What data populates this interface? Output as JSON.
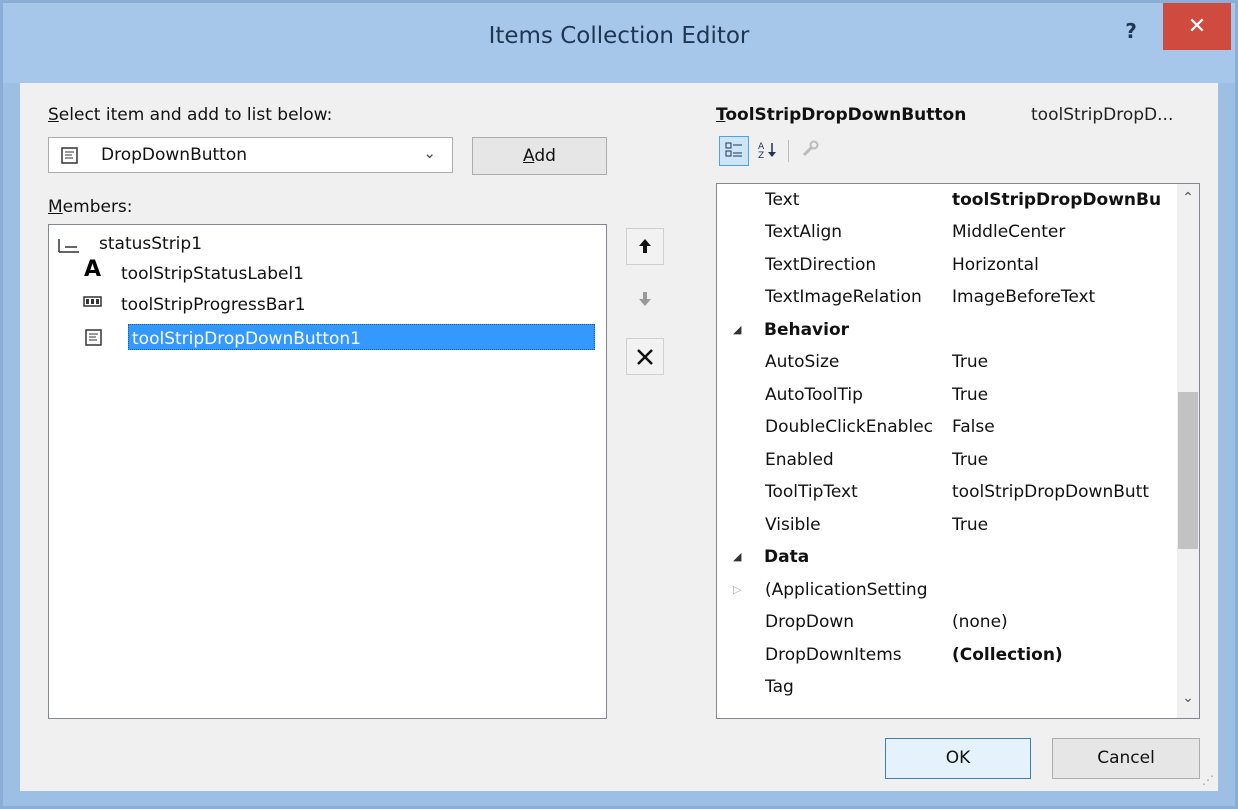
{
  "window": {
    "title": "Items Collection Editor",
    "help_glyph": "?",
    "close_glyph": "✕"
  },
  "left": {
    "select_label_u": "S",
    "select_label_rest": "elect item and add to list below:",
    "combo_value": "DropDownButton",
    "add_label_u": "A",
    "add_label_rest": "dd",
    "members_label_u": "M",
    "members_label_rest": "embers:",
    "tree": [
      {
        "label": "statusStrip1",
        "icon": "status-strip-icon"
      },
      {
        "label": "toolStripStatusLabel1",
        "icon": "label-a-icon"
      },
      {
        "label": "toolStripProgressBar1",
        "icon": "progress-bar-icon"
      },
      {
        "label": "toolStripDropDownButton1",
        "icon": "dropdown-button-icon",
        "selected": true
      }
    ]
  },
  "side_buttons": {
    "up": "move-up-arrow-icon",
    "down": "move-down-arrow-icon",
    "remove": "delete-x-icon"
  },
  "right": {
    "type_name_u": "T",
    "type_name_rest": "oolStripDropDownButton",
    "object_name": "toolStripDropD...",
    "properties": [
      {
        "name": "Text",
        "value": "toolStripDropDownBu",
        "bold_value": true
      },
      {
        "name": "TextAlign",
        "value": "MiddleCenter"
      },
      {
        "name": "TextDirection",
        "value": "Horizontal"
      },
      {
        "name": "TextImageRelation",
        "value": "ImageBeforeText"
      },
      {
        "name": "Behavior",
        "category": true
      },
      {
        "name": "AutoSize",
        "value": "True"
      },
      {
        "name": "AutoToolTip",
        "value": "True"
      },
      {
        "name": "DoubleClickEnablec",
        "value": "False"
      },
      {
        "name": "Enabled",
        "value": "True"
      },
      {
        "name": "ToolTipText",
        "value": "toolStripDropDownButt"
      },
      {
        "name": "Visible",
        "value": "True"
      },
      {
        "name": "Data",
        "category": true
      },
      {
        "name": "(ApplicationSetting",
        "value": "",
        "expandable": true
      },
      {
        "name": "DropDown",
        "value": "(none)"
      },
      {
        "name": "DropDownItems",
        "value": "(Collection)",
        "bold_value": true
      },
      {
        "name": "Tag",
        "value": ""
      }
    ]
  },
  "footer": {
    "ok": "OK",
    "cancel": "Cancel"
  },
  "colors": {
    "title_bg": "#a7c7ea",
    "close_bg": "#cf4b40",
    "selection": "#3399ff",
    "client_bg": "#f0f0f0"
  }
}
